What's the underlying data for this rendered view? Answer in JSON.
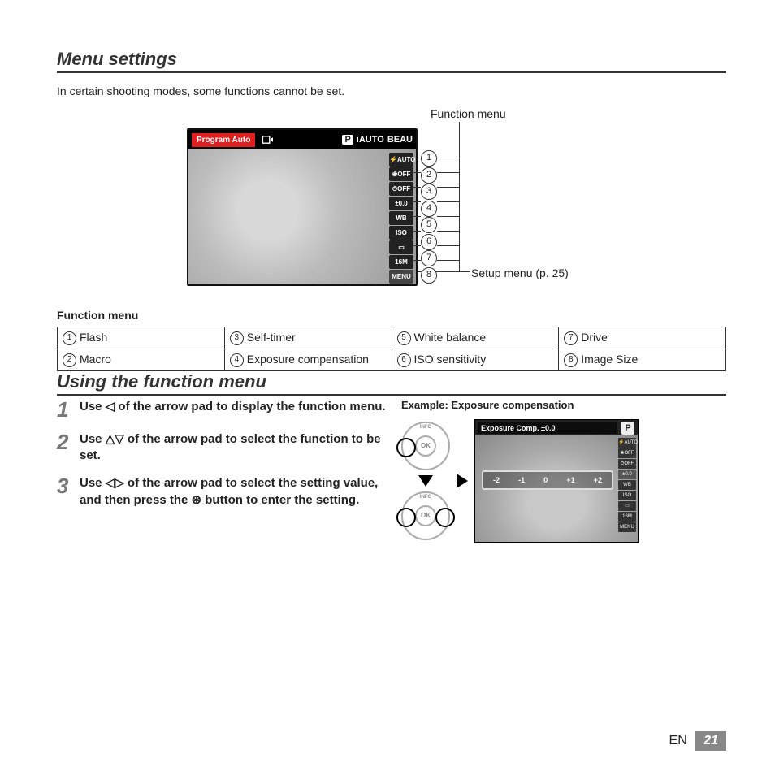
{
  "section1_title": "Menu settings",
  "intro": "In certain shooting modes, some functions cannot be set.",
  "label_function_menu": "Function menu",
  "label_setup_menu": "Setup menu (p. 25)",
  "lcd": {
    "mode_label": "Program Auto",
    "mode_row": [
      "P",
      "iAUTO",
      "BEAU"
    ],
    "side_icons": [
      "⚡AUTO",
      "❀OFF",
      "⏱OFF",
      "±0.0",
      "WB AUTO",
      "ISO AUTO",
      "▭",
      "16M",
      "MENU"
    ]
  },
  "callout_numbers": [
    "1",
    "2",
    "3",
    "4",
    "5",
    "6",
    "7",
    "8"
  ],
  "fn_table_heading": "Function menu",
  "fn_table": [
    [
      {
        "n": "1",
        "t": "Flash"
      },
      {
        "n": "3",
        "t": "Self-timer"
      },
      {
        "n": "5",
        "t": "White balance"
      },
      {
        "n": "7",
        "t": "Drive"
      }
    ],
    [
      {
        "n": "2",
        "t": "Macro"
      },
      {
        "n": "4",
        "t": "Exposure compensation"
      },
      {
        "n": "6",
        "t": "ISO sensitivity"
      },
      {
        "n": "8",
        "t": "Image Size"
      }
    ]
  ],
  "section2_title": "Using the function menu",
  "steps": [
    {
      "n": "1",
      "pre": "Use ",
      "icons": "◁",
      "post": " of the arrow pad to display the function menu."
    },
    {
      "n": "2",
      "pre": "Use ",
      "icons": "△▽",
      "post": " of the arrow pad to select the function to be set."
    },
    {
      "n": "3",
      "pre": "Use ",
      "icons": "◁▷",
      "post": " of the arrow pad to select the setting value, and then press the ⊛ button to enter the setting."
    }
  ],
  "example_title": "Example: Exposure compensation",
  "pad": {
    "info": "INFO",
    "ok": "OK"
  },
  "mini": {
    "title": "Exposure Comp.  ±0.0",
    "P": "P",
    "ev": [
      "-2",
      "-1",
      "0",
      "+1",
      "+2"
    ],
    "side": [
      "⚡AUTO",
      "❀OFF",
      "⏱OFF",
      "±0.0",
      "WB AUTO",
      "ISO AUTO",
      "▭",
      "16M",
      "MENU"
    ]
  },
  "footer_lang": "EN",
  "footer_page": "21"
}
